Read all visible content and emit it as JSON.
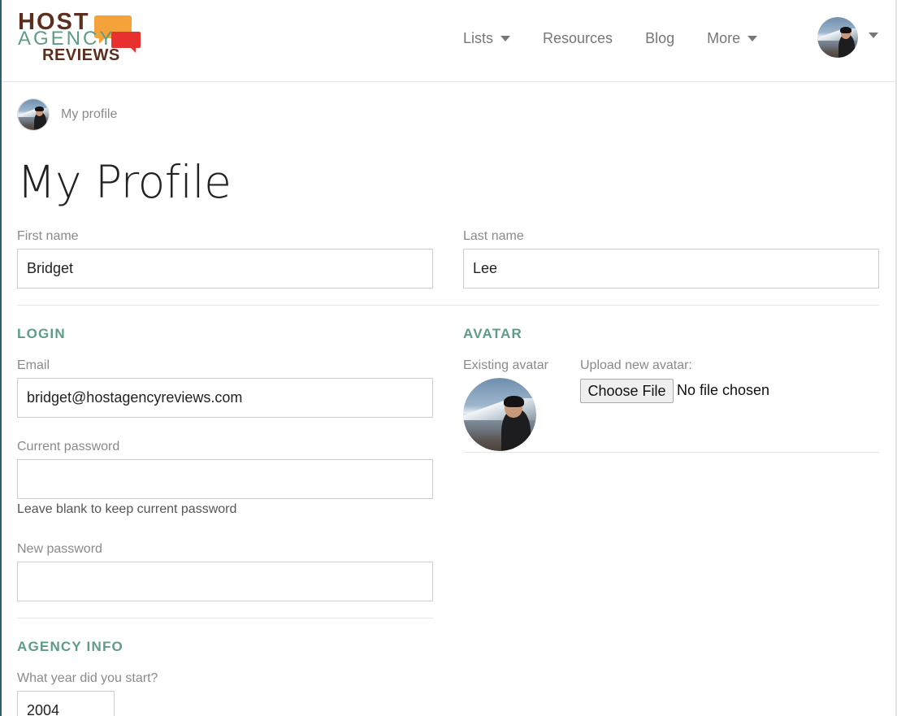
{
  "brand": {
    "line1": "HOST",
    "line2": "AGENCY",
    "line3": "REVIEWS",
    "colors": {
      "brown": "#5b2e1d",
      "green": "#5e9c86",
      "orange": "#f4a23a",
      "red": "#e8312f"
    }
  },
  "nav": {
    "items": [
      {
        "label": "Lists",
        "dropdown": true
      },
      {
        "label": "Resources",
        "dropdown": false
      },
      {
        "label": "Blog",
        "dropdown": false
      },
      {
        "label": "More",
        "dropdown": true
      }
    ]
  },
  "breadcrumb": {
    "label": "My profile"
  },
  "page": {
    "title": "My Profile"
  },
  "form": {
    "first_name": {
      "label": "First name",
      "value": "Bridget"
    },
    "last_name": {
      "label": "Last name",
      "value": "Lee"
    },
    "login": {
      "title": "LOGIN",
      "email": {
        "label": "Email",
        "value": "bridget@hostagencyreviews.com"
      },
      "current_password": {
        "label": "Current password",
        "value": "",
        "help": "Leave blank to keep current password"
      },
      "new_password": {
        "label": "New password",
        "value": ""
      }
    },
    "avatar": {
      "title": "AVATAR",
      "existing_label": "Existing avatar",
      "upload_label": "Upload new avatar:",
      "choose_button": "Choose File",
      "file_status": "No file chosen"
    },
    "agency_info": {
      "title": "AGENCY INFO",
      "year_label": "What year did you start?",
      "year_value": "2004"
    }
  }
}
